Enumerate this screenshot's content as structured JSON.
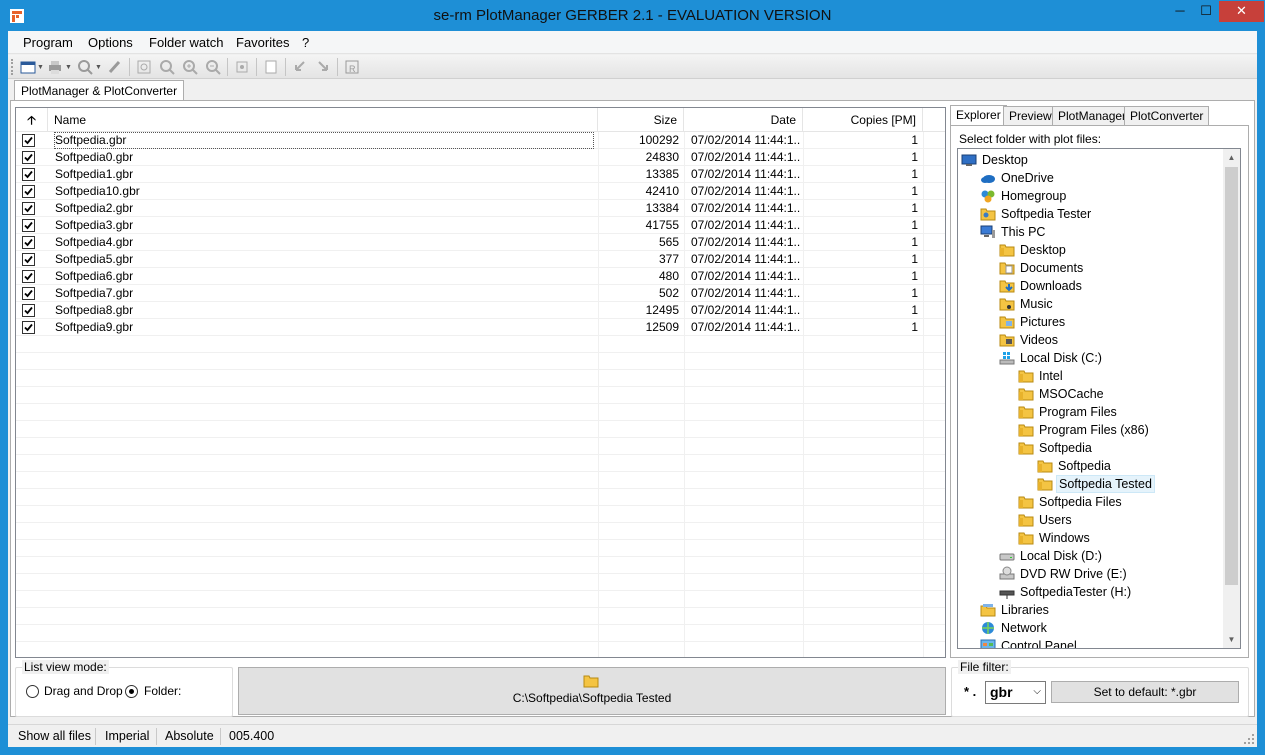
{
  "window": {
    "title": "se-rm PlotManager GERBER 2.1 - EVALUATION VERSION",
    "minimize": "─",
    "maximize": "☐",
    "close": "✕"
  },
  "menu": [
    "Program",
    "Options",
    "Folder watch",
    "Favorites",
    "?"
  ],
  "toolbar_icons": [
    "open-folder-icon",
    "print-icon",
    "zoom-icon",
    "pen-icon",
    "fit-page-icon",
    "zoom-window-icon",
    "zoom-in-icon",
    "zoom-out-icon",
    "pan-icon",
    "page-icon",
    "rotate-left-icon",
    "rotate-right-icon",
    "report-icon"
  ],
  "main_tab": "PlotManager & PlotConverter",
  "list": {
    "columns": {
      "sort": "🡡",
      "name": "Name",
      "size": "Size",
      "date": "Date",
      "copies": "Copies [PM]"
    },
    "rows": [
      {
        "name": "Softpedia.gbr",
        "size": "100292",
        "date": "07/02/2014 11:44:1...",
        "copies": "1",
        "checked": true
      },
      {
        "name": "Softpedia0.gbr",
        "size": "24830",
        "date": "07/02/2014 11:44:1...",
        "copies": "1",
        "checked": true
      },
      {
        "name": "Softpedia1.gbr",
        "size": "13385",
        "date": "07/02/2014 11:44:1...",
        "copies": "1",
        "checked": true
      },
      {
        "name": "Softpedia10.gbr",
        "size": "42410",
        "date": "07/02/2014 11:44:1...",
        "copies": "1",
        "checked": true
      },
      {
        "name": "Softpedia2.gbr",
        "size": "13384",
        "date": "07/02/2014 11:44:1...",
        "copies": "1",
        "checked": true
      },
      {
        "name": "Softpedia3.gbr",
        "size": "41755",
        "date": "07/02/2014 11:44:1...",
        "copies": "1",
        "checked": true
      },
      {
        "name": "Softpedia4.gbr",
        "size": "565",
        "date": "07/02/2014 11:44:1...",
        "copies": "1",
        "checked": true
      },
      {
        "name": "Softpedia5.gbr",
        "size": "377",
        "date": "07/02/2014 11:44:1...",
        "copies": "1",
        "checked": true
      },
      {
        "name": "Softpedia6.gbr",
        "size": "480",
        "date": "07/02/2014 11:44:1...",
        "copies": "1",
        "checked": true
      },
      {
        "name": "Softpedia7.gbr",
        "size": "502",
        "date": "07/02/2014 11:44:1...",
        "copies": "1",
        "checked": true
      },
      {
        "name": "Softpedia8.gbr",
        "size": "12495",
        "date": "07/02/2014 11:44:1...",
        "copies": "1",
        "checked": true
      },
      {
        "name": "Softpedia9.gbr",
        "size": "12509",
        "date": "07/02/2014 11:44:1...",
        "copies": "1",
        "checked": true
      }
    ]
  },
  "right_tabs": [
    "Explorer",
    "Preview",
    "PlotManager",
    "PlotConverter"
  ],
  "explorer": {
    "caption": "Select folder with plot files:",
    "tree": [
      {
        "label": "Desktop",
        "level": 0,
        "icon": "desktop-icon"
      },
      {
        "label": "OneDrive",
        "level": 1,
        "icon": "cloud-icon"
      },
      {
        "label": "Homegroup",
        "level": 1,
        "icon": "homegroup-icon"
      },
      {
        "label": "Softpedia Tester",
        "level": 1,
        "icon": "user-folder-icon"
      },
      {
        "label": "This PC",
        "level": 1,
        "icon": "computer-icon"
      },
      {
        "label": "Desktop",
        "level": 2,
        "icon": "folder-icon"
      },
      {
        "label": "Documents",
        "level": 2,
        "icon": "documents-folder-icon"
      },
      {
        "label": "Downloads",
        "level": 2,
        "icon": "downloads-folder-icon"
      },
      {
        "label": "Music",
        "level": 2,
        "icon": "music-folder-icon"
      },
      {
        "label": "Pictures",
        "level": 2,
        "icon": "pictures-folder-icon"
      },
      {
        "label": "Videos",
        "level": 2,
        "icon": "videos-folder-icon"
      },
      {
        "label": "Local Disk (C:)",
        "level": 2,
        "icon": "system-drive-icon"
      },
      {
        "label": "Intel",
        "level": 3,
        "icon": "folder-icon"
      },
      {
        "label": "MSOCache",
        "level": 3,
        "icon": "folder-icon"
      },
      {
        "label": "Program Files",
        "level": 3,
        "icon": "folder-icon"
      },
      {
        "label": "Program Files (x86)",
        "level": 3,
        "icon": "folder-icon"
      },
      {
        "label": "Softpedia",
        "level": 3,
        "icon": "folder-icon"
      },
      {
        "label": "Softpedia",
        "level": 4,
        "icon": "folder-icon"
      },
      {
        "label": "Softpedia Tested",
        "level": 4,
        "icon": "folder-icon",
        "selected": true
      },
      {
        "label": "Softpedia Files",
        "level": 3,
        "icon": "folder-icon"
      },
      {
        "label": "Users",
        "level": 3,
        "icon": "folder-icon"
      },
      {
        "label": "Windows",
        "level": 3,
        "icon": "folder-icon"
      },
      {
        "label": "Local Disk (D:)",
        "level": 2,
        "icon": "drive-icon"
      },
      {
        "label": "DVD RW Drive (E:)",
        "level": 2,
        "icon": "dvd-drive-icon"
      },
      {
        "label": "SoftpediaTester (H:)",
        "level": 2,
        "icon": "network-drive-icon"
      },
      {
        "label": "Libraries",
        "level": 1,
        "icon": "libraries-icon"
      },
      {
        "label": "Network",
        "level": 1,
        "icon": "network-icon"
      },
      {
        "label": "Control Panel",
        "level": 1,
        "icon": "control-panel-icon"
      }
    ]
  },
  "list_view_mode": {
    "title": "List view mode:",
    "options": [
      {
        "label": "Drag and Drop",
        "selected": false
      },
      {
        "label": "Folder:",
        "selected": true
      }
    ]
  },
  "folder_button": {
    "path": "C:\\Softpedia\\Softpedia Tested"
  },
  "file_filter": {
    "title": "File filter:",
    "prefix": "* .",
    "value": "gbr",
    "default_button": "Set to default: *.gbr"
  },
  "status": [
    "Show all files",
    "Imperial",
    "Absolute",
    "005.400"
  ],
  "colors": {
    "titlebar": "#1e8fd6",
    "close": "#c7403a",
    "folder": "#f4c443"
  }
}
